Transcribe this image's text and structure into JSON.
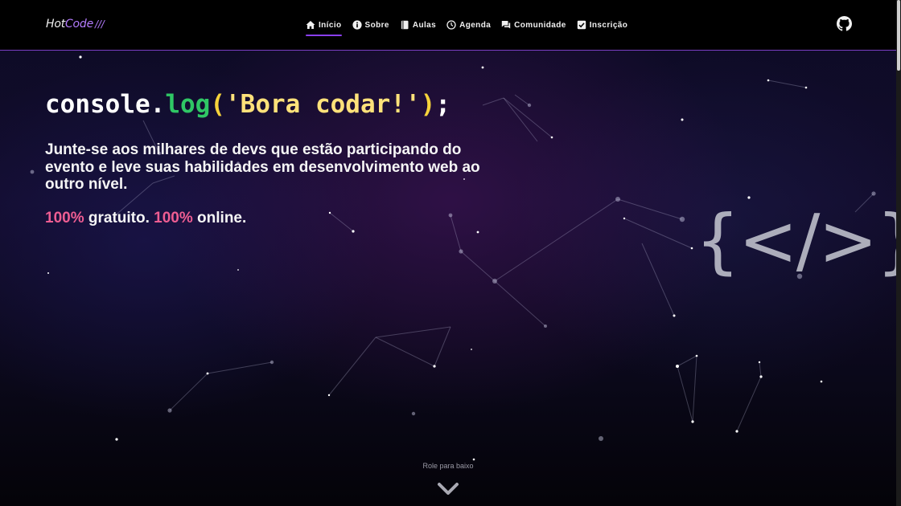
{
  "header": {
    "logo": {
      "part1": "Hot",
      "part2": "Code",
      "bars": "///"
    },
    "nav": [
      {
        "label": "Início",
        "icon": "home-icon"
      },
      {
        "label": "Sobre",
        "icon": "info-icon"
      },
      {
        "label": "Aulas",
        "icon": "book-icon"
      },
      {
        "label": "Agenda",
        "icon": "clock-icon"
      },
      {
        "label": "Comunidade",
        "icon": "chat-icon"
      },
      {
        "label": "Inscrição",
        "icon": "checkbox-icon"
      }
    ],
    "github_icon": "github-icon"
  },
  "hero": {
    "code": {
      "obj": "console",
      "dot": ".",
      "fn": "log",
      "open": "(",
      "str": "'Bora codar!'",
      "close": ")",
      "semi": ";"
    },
    "subtitle": "Junte-se aos milhares de devs que estão participando do evento e leve suas habilidades em desenvolvimento web ao outro nível.",
    "pricing": {
      "pct1": "100%",
      "text1": " gratuito. ",
      "pct2": "100%",
      "text2": " online."
    },
    "code_icon": "{</>}"
  },
  "scroll": {
    "hint": "Role para baixo",
    "icon": "chevron-down-icon"
  },
  "colors": {
    "accent": "#8a3ff0",
    "pink": "#ee5d92",
    "green": "#2fc765",
    "yellow": "#f6d33b"
  }
}
